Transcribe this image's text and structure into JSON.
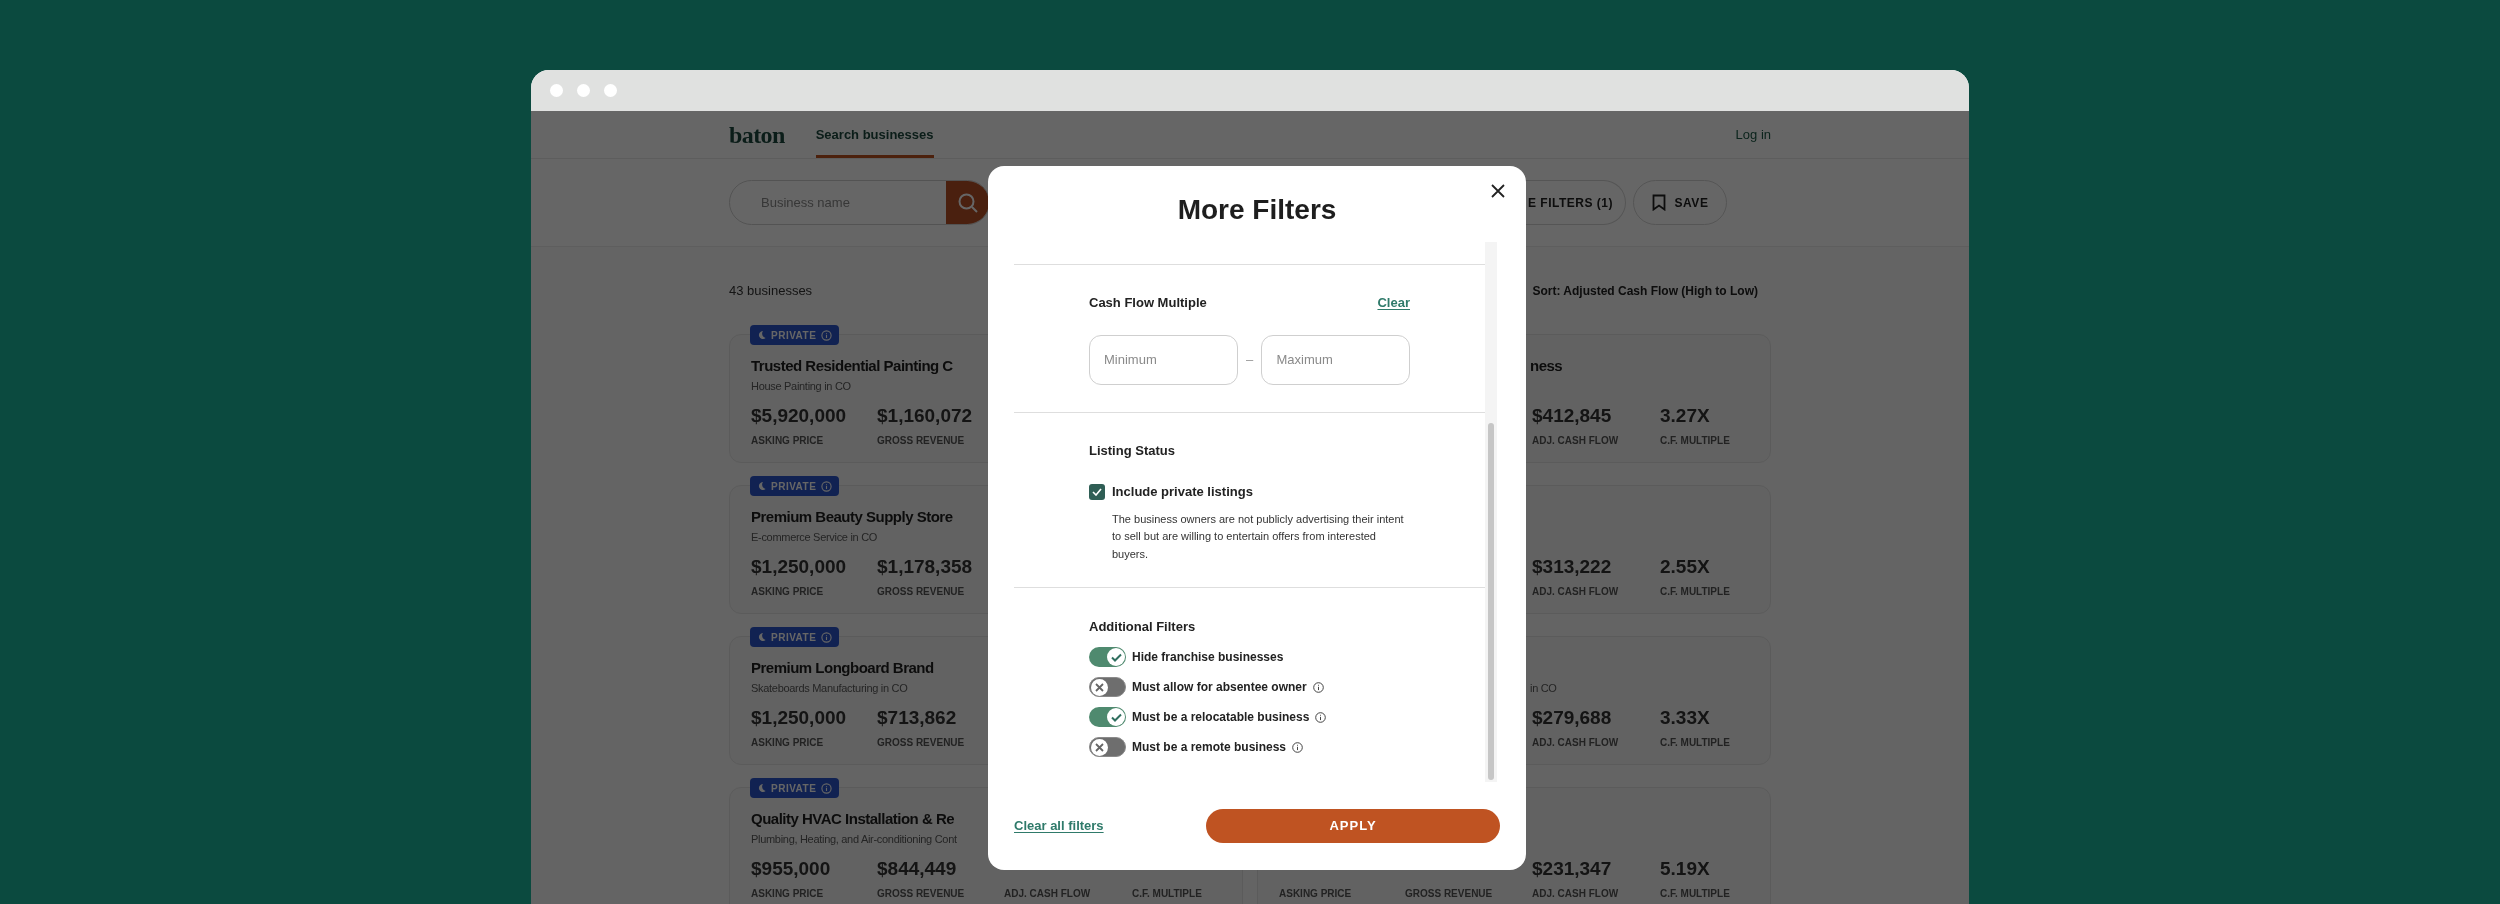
{
  "header": {
    "logo": "baton",
    "nav": [
      {
        "label": "Search businesses",
        "selected": true
      }
    ],
    "login": "Log in"
  },
  "search": {
    "placeholder": "Business name"
  },
  "toolbar_buttons": [
    {
      "kind": "filters",
      "label": "E FILTERS (1)"
    },
    {
      "kind": "save",
      "label": "SAVE"
    }
  ],
  "results": {
    "count": "43 businesses",
    "sort": "Sort: Adjusted Cash Flow (High to Low)"
  },
  "listings": [
    {
      "badge": "PRIVATE",
      "title": "Trusted Residential Painting C",
      "subtitle": "House Painting in CO",
      "asking_price": {
        "value": "$5,920,000",
        "label": "ASKING PRICE"
      },
      "gross_revenue": {
        "value": "$1,160,072",
        "label": "GROSS REVENUE"
      }
    },
    {
      "title": "ness",
      "adj_cash_flow": {
        "value": "$412,845",
        "label": "ADJ. CASH FLOW"
      },
      "cf_multiple": {
        "value": "3.27X",
        "label": "C.F. MULTIPLE"
      }
    },
    {
      "badge": "PRIVATE",
      "title": "Premium Beauty Supply Store",
      "subtitle": "E-commerce Service in CO",
      "asking_price": {
        "value": "$1,250,000",
        "label": "ASKING PRICE"
      },
      "gross_revenue": {
        "value": "$1,178,358",
        "label": "GROSS REVENUE"
      }
    },
    {
      "adj_cash_flow": {
        "value": "$313,222",
        "label": "ADJ. CASH FLOW"
      },
      "cf_multiple": {
        "value": "2.55X",
        "label": "C.F. MULTIPLE"
      }
    },
    {
      "badge": "PRIVATE",
      "title": "Premium Longboard Brand",
      "subtitle": "Skateboards Manufacturing in CO",
      "asking_price": {
        "value": "$1,250,000",
        "label": "ASKING PRICE"
      },
      "gross_revenue": {
        "value": "$713,862",
        "label": "GROSS REVENUE"
      }
    },
    {
      "subtitle": "in CO",
      "adj_cash_flow": {
        "value": "$279,688",
        "label": "ADJ. CASH FLOW"
      },
      "cf_multiple": {
        "value": "3.33X",
        "label": "C.F. MULTIPLE"
      }
    },
    {
      "badge": "PRIVATE",
      "title": "Quality HVAC Installation & Re",
      "subtitle": "Plumbing, Heating, and Air-conditioning Cont",
      "asking_price": {
        "value": "$955,000",
        "label": "ASKING PRICE"
      },
      "gross_revenue": {
        "value": "$844,449",
        "label": "GROSS REVENUE"
      },
      "adj_cash_flow": {
        "label": "ADJ. CASH FLOW"
      },
      "cf_multiple": {
        "label": "C.F. MULTIPLE"
      }
    },
    {
      "asking_price": {
        "label": "ASKING PRICE"
      },
      "gross_revenue": {
        "label": "GROSS REVENUE"
      },
      "adj_cash_flow": {
        "value": "$231,347",
        "label": "ADJ. CASH FLOW"
      },
      "cf_multiple": {
        "value": "5.19X",
        "label": "C.F. MULTIPLE"
      }
    }
  ],
  "modal": {
    "title": "More Filters",
    "sections": [
      {
        "kind": "range",
        "heading": "Cash Flow Multiple",
        "clear": "Clear",
        "min_placeholder": "Minimum",
        "separator": "–",
        "max_placeholder": "Maximum"
      },
      {
        "kind": "checkbox",
        "heading": "Listing Status",
        "label": "Include private listings",
        "checked": true,
        "description": "The business owners are not publicly advertising their intent to sell but are willing to entertain offers from interested buyers."
      },
      {
        "kind": "toggles",
        "heading": "Additional Filters",
        "toggles": [
          {
            "label": "Hide franchise businesses",
            "on": true,
            "info": false
          },
          {
            "label": "Must allow for absentee owner",
            "on": false,
            "info": true
          },
          {
            "label": "Must be a relocatable business",
            "on": true,
            "info": true
          },
          {
            "label": "Must be a remote business",
            "on": false,
            "info": true
          }
        ]
      }
    ],
    "clear_all": "Clear all filters",
    "apply": "APPLY"
  }
}
